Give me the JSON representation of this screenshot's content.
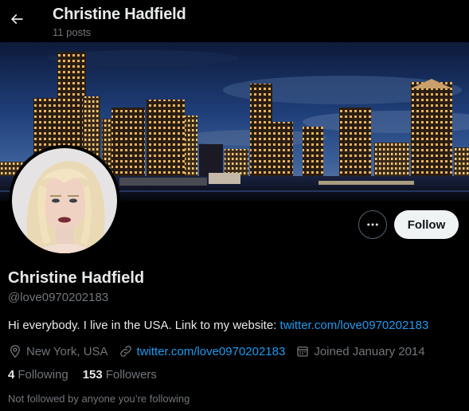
{
  "header": {
    "title": "Christine Hadfield",
    "posts_count": "11 posts"
  },
  "profile": {
    "display_name": "Christine Hadfield",
    "handle": "@love0970202183",
    "bio_text": "Hi everybody. I live in the USA. Link to my website: ",
    "bio_link": "twitter.com/love0970202183",
    "location": "New York, USA",
    "website": "twitter.com/love0970202183",
    "joined": "Joined January 2014",
    "following_count": "4",
    "following_label": "Following",
    "followers_count": "153",
    "followers_label": "Followers",
    "not_followed_text": "Not followed by anyone you’re following"
  },
  "actions": {
    "follow_label": "Follow"
  },
  "icons": {
    "back": "arrow-left-icon",
    "more": "more-dots-icon",
    "location": "location-pin-icon",
    "link": "link-icon",
    "calendar": "calendar-icon"
  },
  "colors": {
    "background": "#000000",
    "accent_link": "#1d9bf0",
    "text_primary": "#e7e9ea",
    "text_secondary": "#71767b",
    "follow_button_bg": "#eff3f4"
  }
}
